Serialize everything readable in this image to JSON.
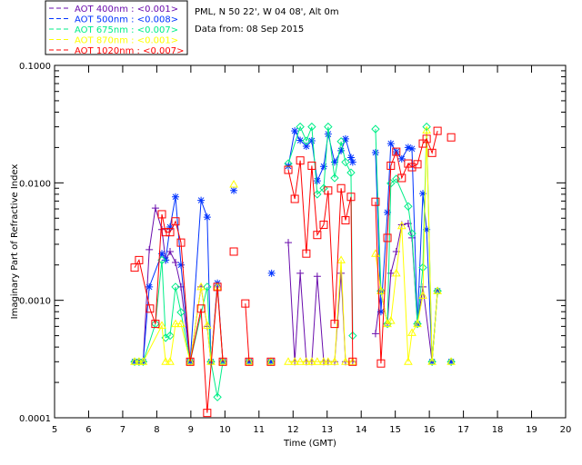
{
  "chart_data": {
    "type": "line",
    "info_lines": [
      "PML, N 50 22', W 04 08', Alt 0m",
      "Data from: 08 Sep 2015"
    ],
    "xlabel": "Time (GMT)",
    "ylabel": "Imaginary Part of Refractive Index",
    "xlim": [
      5,
      20
    ],
    "ylim": [
      0.0001,
      0.1
    ],
    "yscale": "log",
    "x_ticks": [
      "5",
      "6",
      "7",
      "8",
      "9",
      "10",
      "11",
      "12",
      "13",
      "14",
      "15",
      "16",
      "17",
      "18",
      "19",
      "20"
    ],
    "y_ticks": [
      "0.0001",
      "0.0010",
      "0.0100",
      "0.1000"
    ],
    "legend_position": "top-left outside",
    "series": [
      {
        "name": "AOT  400nm : <0.001>",
        "color": "#6a0dad",
        "marker": "plus",
        "points": [
          [
            7.35,
            0.0003
          ],
          [
            7.48,
            0.0003
          ],
          [
            7.6,
            0.0003
          ],
          [
            7.78,
            0.0027
          ],
          [
            7.96,
            0.0061
          ],
          [
            8.15,
            0.004
          ],
          [
            8.26,
            0.0022
          ],
          [
            8.39,
            0.0026
          ],
          [
            8.55,
            0.0021
          ],
          [
            8.71,
            0.0013
          ],
          [
            8.98,
            0.0003
          ],
          [
            9.3,
            0.0013
          ],
          [
            9.48,
            0.0006
          ],
          [
            9.59,
            0.0003
          ],
          [
            9.78,
            0.0013
          ],
          [
            9.94,
            0.0003
          ],
          null,
          [
            10.71,
            0.0003
          ],
          null,
          [
            11.35,
            0.0003
          ],
          null,
          [
            11.86,
            0.0031
          ],
          [
            12.05,
            0.0003
          ],
          [
            12.21,
            0.0017
          ],
          [
            12.39,
            0.0003
          ],
          [
            12.55,
            0.0003
          ],
          [
            12.71,
            0.0016
          ],
          [
            12.9,
            0.0003
          ],
          [
            13.03,
            0.0003
          ],
          [
            13.22,
            0.0003
          ],
          [
            13.41,
            0.0017
          ],
          [
            13.54,
            0.0003
          ],
          [
            13.75,
            0.0003
          ],
          null,
          [
            14.42,
            0.00052
          ],
          [
            14.58,
            0.0012
          ],
          [
            14.77,
            0.00063
          ],
          [
            14.87,
            0.0017
          ],
          [
            15.03,
            0.0026
          ],
          [
            15.19,
            0.0044
          ],
          [
            15.38,
            0.0045
          ],
          [
            15.49,
            0.0034
          ],
          [
            15.65,
            0.00063
          ],
          [
            15.81,
            0.0013
          ],
          [
            16.08,
            0.0003
          ],
          [
            16.24,
            0.0012
          ],
          null,
          [
            16.64,
            0.0003
          ]
        ]
      },
      {
        "name": "AOT  500nm : <0.008>",
        "color": "#0033ff",
        "marker": "asterisk",
        "points": [
          [
            7.35,
            0.0003
          ],
          [
            7.48,
            0.0003
          ],
          [
            7.6,
            0.0003
          ],
          [
            7.78,
            0.0013
          ],
          [
            8.15,
            0.0025
          ],
          [
            8.26,
            0.0022
          ],
          [
            8.39,
            0.0042
          ],
          [
            8.55,
            0.0076
          ],
          [
            8.71,
            0.002
          ],
          [
            8.98,
            0.0003
          ],
          [
            9.3,
            0.0071
          ],
          [
            9.48,
            0.0051
          ],
          [
            9.59,
            0.0003
          ],
          [
            9.78,
            0.0014
          ],
          [
            9.94,
            0.0003
          ],
          null,
          [
            10.26,
            0.0086
          ],
          null,
          [
            10.71,
            0.0003
          ],
          null,
          [
            11.35,
            0.0003
          ],
          null,
          [
            11.37,
            0.0017
          ],
          null,
          [
            11.86,
            0.0139
          ],
          [
            12.05,
            0.0277
          ],
          [
            12.21,
            0.023
          ],
          [
            12.39,
            0.0205
          ],
          [
            12.55,
            0.0228
          ],
          [
            12.71,
            0.0104
          ],
          [
            12.9,
            0.0138
          ],
          [
            13.03,
            0.026
          ],
          [
            13.22,
            0.015
          ],
          [
            13.41,
            0.0188
          ],
          [
            13.54,
            0.0237
          ],
          [
            13.7,
            0.0164
          ],
          [
            13.75,
            0.015
          ],
          null,
          [
            14.42,
            0.0181
          ],
          [
            14.58,
            0.0008
          ],
          [
            14.77,
            0.0056
          ],
          [
            14.87,
            0.0216
          ],
          [
            15.03,
            0.0184
          ],
          [
            15.19,
            0.016
          ],
          [
            15.38,
            0.02
          ],
          [
            15.49,
            0.0195
          ],
          [
            15.65,
            0.00063
          ],
          [
            15.81,
            0.0081
          ],
          [
            15.92,
            0.004
          ],
          [
            16.08,
            0.0003
          ],
          [
            16.24,
            0.0012
          ],
          null,
          [
            16.64,
            0.0003
          ]
        ]
      },
      {
        "name": "AOT  675nm : <0.007>",
        "color": "#00ee88",
        "marker": "diamond",
        "points": [
          [
            7.35,
            0.0003
          ],
          [
            7.48,
            0.0003
          ],
          [
            7.6,
            0.0003
          ],
          [
            7.96,
            0.00063
          ],
          [
            8.15,
            0.0022
          ],
          [
            8.26,
            0.00048
          ],
          [
            8.39,
            0.0005
          ],
          [
            8.55,
            0.0013
          ],
          [
            8.71,
            0.00079
          ],
          [
            8.98,
            0.0003
          ],
          [
            9.48,
            0.0013
          ],
          [
            9.59,
            0.0003
          ],
          [
            9.78,
            0.00015
          ],
          [
            9.94,
            0.0003
          ],
          null,
          [
            10.71,
            0.0003
          ],
          null,
          [
            11.35,
            0.0003
          ],
          null,
          [
            11.86,
            0.0146
          ],
          [
            12.21,
            0.03
          ],
          [
            12.39,
            0.0228
          ],
          [
            12.55,
            0.03
          ],
          [
            12.71,
            0.008
          ],
          [
            12.9,
            0.009
          ],
          [
            13.03,
            0.03
          ],
          [
            13.22,
            0.011
          ],
          [
            13.41,
            0.0225
          ],
          [
            13.54,
            0.015
          ],
          [
            13.7,
            0.0122
          ],
          [
            13.75,
            0.0005
          ],
          null,
          [
            14.42,
            0.0287
          ],
          [
            14.58,
            0.0012
          ],
          [
            14.77,
            0.00063
          ],
          [
            14.87,
            0.0099
          ],
          [
            15.03,
            0.0108
          ],
          [
            15.38,
            0.0063
          ],
          [
            15.49,
            0.0037
          ],
          [
            15.65,
            0.00063
          ],
          [
            15.81,
            0.0019
          ],
          [
            15.92,
            0.03
          ],
          [
            16.08,
            0.0003
          ],
          [
            16.24,
            0.0012
          ],
          null,
          [
            16.64,
            0.0003
          ]
        ]
      },
      {
        "name": "AOT  870nm : <0.001>",
        "color": "#ffff00",
        "marker": "triangle",
        "points": [
          [
            7.35,
            0.0003
          ],
          [
            7.48,
            0.0003
          ],
          [
            7.6,
            0.0003
          ],
          [
            8.15,
            0.00061
          ],
          [
            8.26,
            0.0003
          ],
          [
            8.39,
            0.0003
          ],
          [
            8.55,
            0.00063
          ],
          [
            8.71,
            0.00063
          ],
          [
            8.98,
            0.0003
          ],
          [
            9.3,
            0.0013
          ],
          [
            9.48,
            0.00061
          ],
          [
            9.59,
            0.0003
          ],
          [
            9.78,
            0.0013
          ],
          [
            9.94,
            0.0003
          ],
          null,
          [
            10.26,
            0.0097
          ],
          null,
          [
            10.71,
            0.0003
          ],
          null,
          [
            11.35,
            0.0003
          ],
          null,
          [
            11.86,
            0.0003
          ],
          [
            12.05,
            0.0003
          ],
          [
            12.21,
            0.0003
          ],
          [
            12.39,
            0.0003
          ],
          [
            12.55,
            0.0003
          ],
          [
            12.71,
            0.0003
          ],
          [
            12.9,
            0.0003
          ],
          [
            13.03,
            0.0003
          ],
          [
            13.22,
            0.0003
          ],
          [
            13.41,
            0.0022
          ],
          [
            13.54,
            0.0003
          ],
          [
            13.75,
            0.0003
          ],
          null,
          [
            14.42,
            0.0025
          ],
          [
            14.58,
            0.0012
          ],
          [
            14.77,
            0.00063
          ],
          [
            14.87,
            0.00067
          ],
          [
            15.03,
            0.0017
          ],
          [
            15.19,
            0.0043
          ],
          [
            15.38,
            0.0003
          ],
          [
            15.49,
            0.00053
          ],
          [
            15.65,
            0.00063
          ],
          [
            15.81,
            0.0011
          ],
          [
            15.92,
            0.028
          ],
          [
            16.08,
            0.0003
          ],
          [
            16.24,
            0.0012
          ],
          null,
          [
            16.64,
            0.0003
          ]
        ]
      },
      {
        "name": "AOT 1020nm : <0.007>",
        "color": "#ff0000",
        "marker": "square",
        "points": [
          [
            7.35,
            0.0019
          ],
          [
            7.48,
            0.0022
          ],
          [
            7.8,
            0.00085
          ],
          [
            7.96,
            0.00063
          ],
          [
            8.15,
            0.0054
          ],
          [
            8.26,
            0.0038
          ],
          [
            8.39,
            0.0038
          ],
          [
            8.55,
            0.0047
          ],
          [
            8.71,
            0.0031
          ],
          [
            8.98,
            0.0003
          ],
          [
            9.3,
            0.00085
          ],
          [
            9.48,
            0.00011
          ],
          [
            9.78,
            0.0013
          ],
          [
            9.94,
            0.0003
          ],
          null,
          [
            10.26,
            0.0026
          ],
          null,
          [
            10.6,
            0.00094
          ],
          [
            10.71,
            0.0003
          ],
          null,
          [
            11.35,
            0.0003
          ],
          null,
          [
            11.86,
            0.0129
          ],
          [
            12.05,
            0.0073
          ],
          [
            12.21,
            0.0155
          ],
          [
            12.39,
            0.0025
          ],
          [
            12.55,
            0.014
          ],
          [
            12.71,
            0.0036
          ],
          [
            12.9,
            0.0044
          ],
          [
            13.03,
            0.0086
          ],
          [
            13.22,
            0.00063
          ],
          [
            13.41,
            0.009
          ],
          [
            13.54,
            0.0048
          ],
          [
            13.7,
            0.0076
          ],
          [
            13.75,
            0.0003
          ],
          null,
          [
            14.42,
            0.0069
          ],
          [
            14.58,
            0.00029
          ],
          [
            14.77,
            0.0034
          ],
          [
            14.87,
            0.014
          ],
          [
            15.03,
            0.0184
          ],
          [
            15.19,
            0.011
          ],
          [
            15.38,
            0.0146
          ],
          [
            15.49,
            0.0136
          ],
          [
            15.65,
            0.0144
          ],
          [
            15.81,
            0.0216
          ],
          [
            15.92,
            0.0237
          ],
          [
            16.08,
            0.018
          ],
          [
            16.24,
            0.0277
          ],
          null,
          [
            16.64,
            0.0244
          ]
        ]
      }
    ]
  }
}
